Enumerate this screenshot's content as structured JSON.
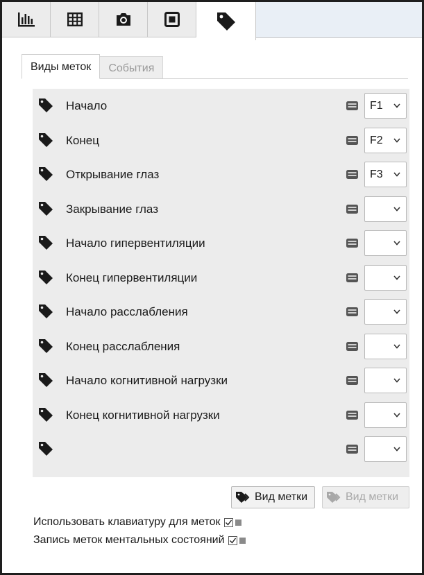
{
  "toolbar": {
    "tabs": [
      {
        "icon": "bar-chart-icon",
        "active": false
      },
      {
        "icon": "grid-table-icon",
        "active": false
      },
      {
        "icon": "camera-icon",
        "active": false
      },
      {
        "icon": "stop-square-icon",
        "active": false
      },
      {
        "icon": "tag-icon",
        "active": true
      }
    ]
  },
  "subtabs": {
    "marker_types": "Виды меток",
    "events": "События"
  },
  "markers": [
    {
      "label": "Начало",
      "key": "F1"
    },
    {
      "label": "Конец",
      "key": "F2"
    },
    {
      "label": "Открывание глаз",
      "key": "F3"
    },
    {
      "label": "Закрывание глаз",
      "key": ""
    },
    {
      "label": "Начало гипервентиляции",
      "key": ""
    },
    {
      "label": "Конец гипервентиляции",
      "key": ""
    },
    {
      "label": "Начало расслабления",
      "key": ""
    },
    {
      "label": "Конец расслабления",
      "key": ""
    },
    {
      "label": "Начало когнитивной нагрузки",
      "key": ""
    },
    {
      "label": "Конец когнитивной нагрузки",
      "key": ""
    },
    {
      "label": "",
      "key": ""
    }
  ],
  "buttons": {
    "add_marker_type": "Вид метки",
    "remove_marker_type": "Вид метки"
  },
  "options": {
    "use_keyboard": {
      "label": "Использовать клавиатуру для меток",
      "checked": true
    },
    "record_mental_states": {
      "label": "Запись меток ментальных состояний",
      "checked": true
    }
  },
  "colors": {
    "list_background": "#ececec",
    "icon": "#1a1a1a",
    "disabled_text": "#a8a8a8"
  }
}
